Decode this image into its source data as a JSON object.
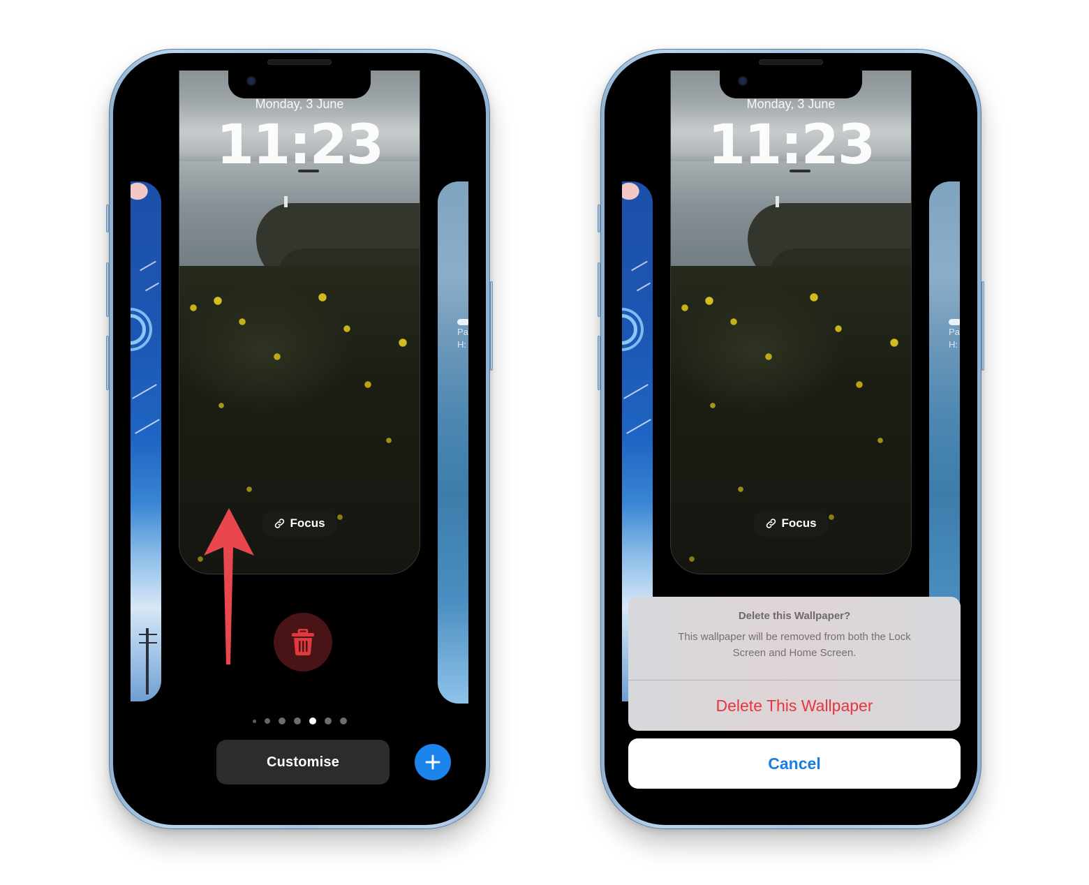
{
  "colors": {
    "phone_frame": "#a9c7e4",
    "screen_bg": "#000000",
    "accent_blue": "#1a84ec",
    "destructive_red": "#e5363f",
    "annotation_red": "#e8474d",
    "trash_bg": "#4a1416"
  },
  "left_phone": {
    "lock_screen": {
      "date": "Monday, 3 June",
      "time": "11:23",
      "focus_label": "Focus",
      "focus_icon": "link-icon"
    },
    "side_peek_right": {
      "weather_line1": "Pa",
      "weather_line2": "H:",
      "weather_icon": "partly-cloudy-icon"
    },
    "delete_button_icon": "trash-icon",
    "annotation": "arrow-up-icon",
    "page_indicator": {
      "count": 7,
      "active_index": 4
    },
    "customise_label": "Customise",
    "add_button_icon": "plus-icon"
  },
  "right_phone": {
    "lock_screen": {
      "date": "Monday, 3 June",
      "time": "11:23",
      "focus_label": "Focus",
      "focus_icon": "link-icon"
    },
    "side_peek_right": {
      "weather_line1": "Pa",
      "weather_line2": "H:",
      "weather_icon": "partly-cloudy-icon"
    },
    "action_sheet": {
      "title": "Delete this Wallpaper?",
      "message_line1": "This wallpaper will be removed from both the Lock",
      "message_line2": "Screen and Home Screen.",
      "destructive_action": "Delete This Wallpaper",
      "cancel_label": "Cancel"
    }
  }
}
